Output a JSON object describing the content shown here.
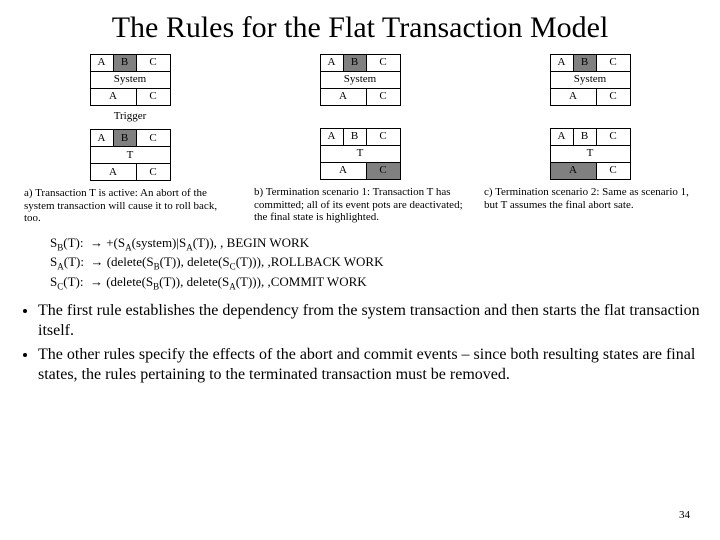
{
  "title": "The Rules for the Flat Transaction Model",
  "labels": {
    "A": "A",
    "B": "B",
    "C": "C",
    "System": "System",
    "T": "T",
    "Trigger": "Trigger"
  },
  "captions": {
    "a": "a) Transaction T is active: An abort of the system transaction will cause it to roll back, too.",
    "b": "b) Termination scenario 1: Transaction T has committed; all of its event pots are deactivated; the final state is highlighted.",
    "c": "c) Termination scenario 2: Same as scenario 1, but T assumes the final abort sate."
  },
  "rule_lines": {
    "sb": "SB(T):  → +(SA(system)|SA(T)), , BEGIN WORK",
    "sa": "SA(T):  → (delete(SB(T)), delete(SC(T))), ,ROLLBACK WORK",
    "sc": "SC(T):  → (delete(SB(T)), delete(SA(T))), ,COMMIT WORK"
  },
  "bullet1": "The first rule establishes the dependency from the system transaction and then starts the flat transaction itself.",
  "bullet2": "The other rules specify the effects of the abort and commit events – since both resulting states are final states, the rules pertaining to the terminated transaction must be removed.",
  "page": "34"
}
